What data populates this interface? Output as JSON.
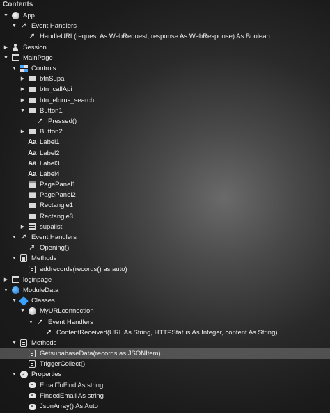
{
  "header": {
    "title": "Contents"
  },
  "tree": [
    {
      "depth": 0,
      "disc": "down",
      "icon": "app",
      "label": "App"
    },
    {
      "depth": 1,
      "disc": "down",
      "icon": "cursor",
      "label": "Event Handlers"
    },
    {
      "depth": 2,
      "disc": "none",
      "icon": "cursor",
      "label": "HandleURL(request As WebRequest, response As WebResponse) As Boolean"
    },
    {
      "depth": 0,
      "disc": "right",
      "icon": "person",
      "label": "Session"
    },
    {
      "depth": 0,
      "disc": "down",
      "icon": "window",
      "label": "MainPage"
    },
    {
      "depth": 1,
      "disc": "down",
      "icon": "controls",
      "label": "Controls"
    },
    {
      "depth": 2,
      "disc": "right",
      "icon": "rect",
      "label": "btnSupa"
    },
    {
      "depth": 2,
      "disc": "right",
      "icon": "rect",
      "label": "btn_callApi"
    },
    {
      "depth": 2,
      "disc": "right",
      "icon": "rect",
      "label": "btn_elorus_search"
    },
    {
      "depth": 2,
      "disc": "down",
      "icon": "rect",
      "label": "Button1"
    },
    {
      "depth": 3,
      "disc": "none",
      "icon": "cursor",
      "label": "Pressed()"
    },
    {
      "depth": 2,
      "disc": "right",
      "icon": "rect",
      "label": "Button2"
    },
    {
      "depth": 2,
      "disc": "none",
      "icon": "aa",
      "label": "Label1"
    },
    {
      "depth": 2,
      "disc": "none",
      "icon": "aa",
      "label": "Label2"
    },
    {
      "depth": 2,
      "disc": "none",
      "icon": "aa",
      "label": "Label3"
    },
    {
      "depth": 2,
      "disc": "none",
      "icon": "aa",
      "label": "Label4"
    },
    {
      "depth": 2,
      "disc": "none",
      "icon": "panel",
      "label": "PagePanel1"
    },
    {
      "depth": 2,
      "disc": "none",
      "icon": "panel",
      "label": "PagePanel2"
    },
    {
      "depth": 2,
      "disc": "none",
      "icon": "rect",
      "label": "Rectangle1"
    },
    {
      "depth": 2,
      "disc": "none",
      "icon": "rect",
      "label": "Rectangle3"
    },
    {
      "depth": 2,
      "disc": "right",
      "icon": "list",
      "label": "supalist"
    },
    {
      "depth": 1,
      "disc": "down",
      "icon": "cursor",
      "label": "Event Handlers"
    },
    {
      "depth": 2,
      "disc": "none",
      "icon": "cursor",
      "label": "Opening()"
    },
    {
      "depth": 1,
      "disc": "down",
      "icon": "method",
      "label": "Methods"
    },
    {
      "depth": 2,
      "disc": "none",
      "icon": "method",
      "label": "addrecords(records() as auto)"
    },
    {
      "depth": 0,
      "disc": "right",
      "icon": "window",
      "label": "loginpage"
    },
    {
      "depth": 0,
      "disc": "down",
      "icon": "globe",
      "label": "ModuleData"
    },
    {
      "depth": 1,
      "disc": "down",
      "icon": "cube",
      "label": "Classes"
    },
    {
      "depth": 2,
      "disc": "down",
      "icon": "app",
      "label": "MyURLconnection"
    },
    {
      "depth": 3,
      "disc": "down",
      "icon": "cursor",
      "label": "Event Handlers"
    },
    {
      "depth": 4,
      "disc": "none",
      "icon": "cursor",
      "label": "ContentReceived(URL As String, HTTPStatus As Integer, content As String)"
    },
    {
      "depth": 1,
      "disc": "down",
      "icon": "method",
      "label": "Methods"
    },
    {
      "depth": 2,
      "disc": "none",
      "icon": "method",
      "label": "GetsupabaseData(records as JSONItem)",
      "selected": true
    },
    {
      "depth": 2,
      "disc": "none",
      "icon": "method",
      "label": "TriggerCollect()"
    },
    {
      "depth": 1,
      "disc": "down",
      "icon": "check",
      "label": "Properties"
    },
    {
      "depth": 2,
      "disc": "none",
      "icon": "prop",
      "label": "EmailToFind As string"
    },
    {
      "depth": 2,
      "disc": "none",
      "icon": "prop",
      "label": "FindedEmail As string"
    },
    {
      "depth": 2,
      "disc": "none",
      "icon": "prop",
      "label": "JsonArray() As Auto"
    }
  ]
}
